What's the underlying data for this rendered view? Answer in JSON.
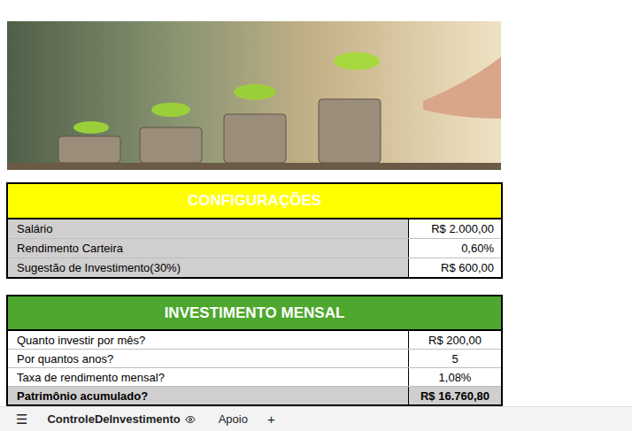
{
  "config": {
    "title": "CONFIGURAÇÕES",
    "rows": [
      {
        "label": "Salário",
        "value": "R$ 2.000,00"
      },
      {
        "label": "Rendimento Carteira",
        "value": "0,60%"
      },
      {
        "label": "Sugestão de Investimento(30%)",
        "value": "R$ 600,00"
      }
    ]
  },
  "investment": {
    "title": "INVESTIMENTO MENSAL",
    "rows": [
      {
        "label": "Quanto investir por mês?",
        "value": "R$ 200,00",
        "kind": "input"
      },
      {
        "label": "Por quantos anos?",
        "value": "5",
        "kind": "input"
      },
      {
        "label": "Taxa de rendimento mensal?",
        "value": "1,08%",
        "kind": "input"
      },
      {
        "label": "Patrimônio acumulado?",
        "value": "R$ 16.760,80",
        "kind": "total"
      }
    ]
  },
  "sheet_bar": {
    "menu_icon": "☰",
    "add_icon": "+",
    "tabs": [
      {
        "label": "ControleDeInvestimento",
        "selected": true
      },
      {
        "label": "Apoio",
        "selected": false
      }
    ]
  }
}
